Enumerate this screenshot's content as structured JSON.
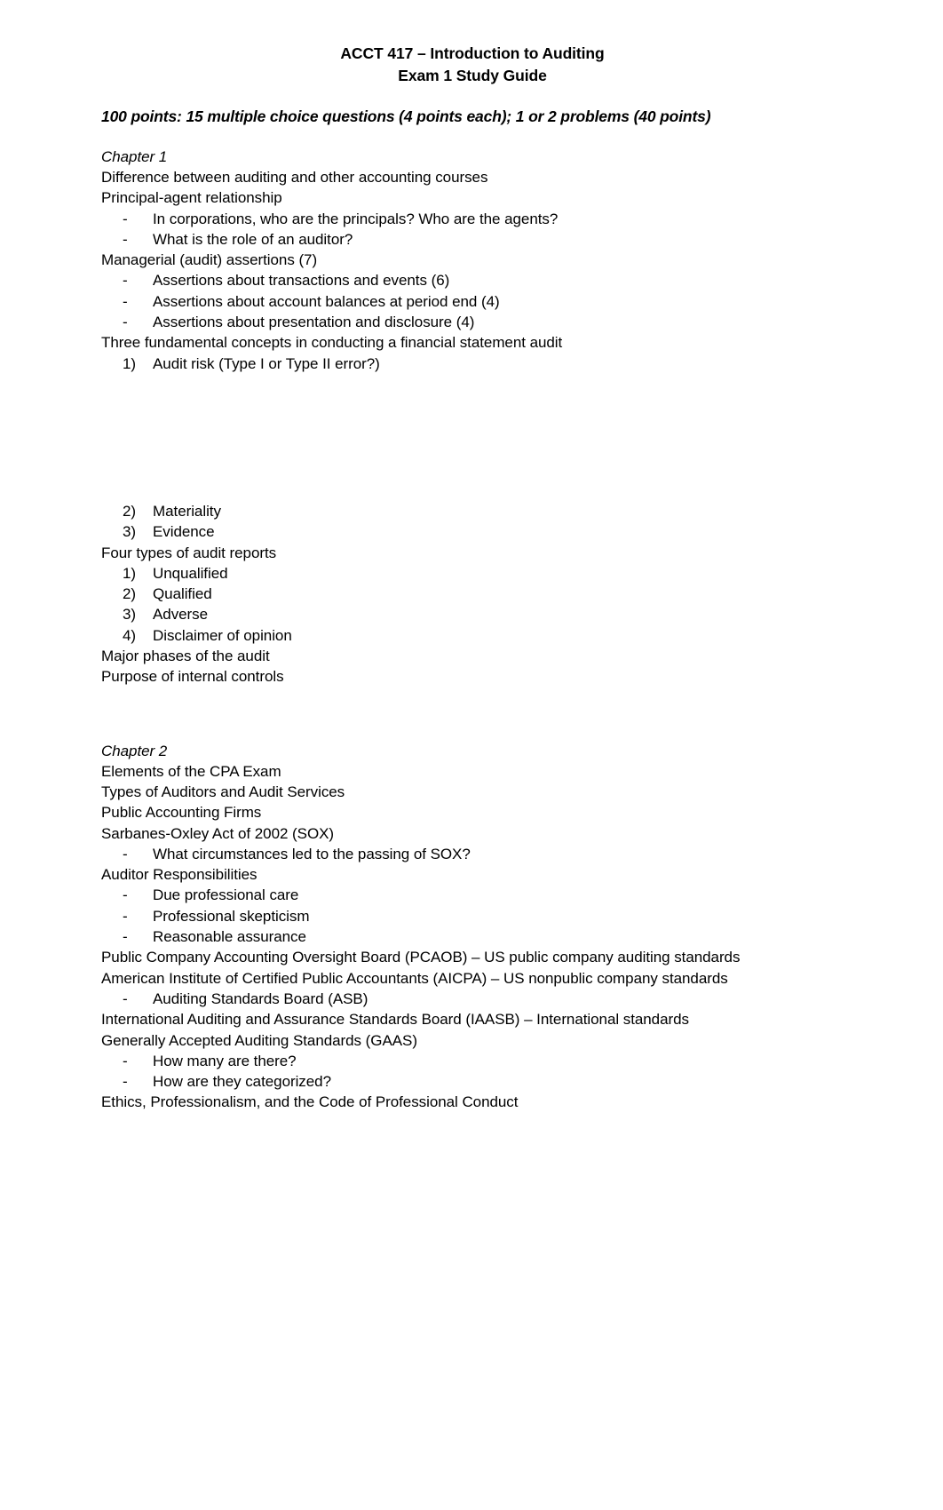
{
  "header": {
    "title": "ACCT 417 – Introduction to Auditing",
    "subtitle": "Exam 1 Study Guide",
    "exam_format": "100 points: 15 multiple choice questions (4 points each); 1 or 2 problems (40 points)"
  },
  "chapter1": {
    "heading": "Chapter 1",
    "line1": "Difference between auditing and other accounting courses",
    "line2": "Principal-agent relationship",
    "sub1": {
      "mark": "-",
      "text": "In corporations, who are the principals? Who are the agents?"
    },
    "sub2": {
      "mark": "-",
      "text": "What is the role of an auditor?"
    },
    "line3": "Managerial (audit) assertions (7)",
    "sub3": {
      "mark": "-",
      "text": "Assertions about transactions and events (6)"
    },
    "sub4": {
      "mark": "-",
      "text": "Assertions about account balances at period end (4)"
    },
    "sub5": {
      "mark": "-",
      "text": "Assertions about presentation and disclosure (4)"
    },
    "line4": "Three fundamental concepts in conducting a financial statement audit",
    "num1": {
      "mark": "1)",
      "text": "Audit risk (Type I or Type II error?)"
    },
    "num2": {
      "mark": "2)",
      "text": "Materiality"
    },
    "num3": {
      "mark": "3)",
      "text": "Evidence"
    },
    "line5": "Four types of audit reports",
    "rep1": {
      "mark": "1)",
      "text": "Unqualified"
    },
    "rep2": {
      "mark": "2)",
      "text": "Qualified"
    },
    "rep3": {
      "mark": "3)",
      "text": "Adverse"
    },
    "rep4": {
      "mark": "4)",
      "text": "Disclaimer of opinion"
    },
    "line6": "Major phases of the audit",
    "line7": "Purpose of internal controls"
  },
  "chapter2": {
    "heading": "Chapter 2",
    "line1": "Elements of the CPA Exam",
    "line2": "Types of Auditors and Audit Services",
    "line3": "Public Accounting Firms",
    "line4": "Sarbanes-Oxley Act of 2002 (SOX)",
    "sub1": {
      "mark": "-",
      "text": "What circumstances led to the passing of SOX?"
    },
    "line5": "Auditor Responsibilities",
    "sub2": {
      "mark": "-",
      "text": "Due professional care"
    },
    "sub3": {
      "mark": "-",
      "text": "Professional skepticism"
    },
    "sub4": {
      "mark": "-",
      "text": "Reasonable assurance"
    },
    "line6": "Public Company Accounting Oversight Board (PCAOB) – US public company auditing standards",
    "line7": "American Institute of Certified Public Accountants (AICPA) – US nonpublic company standards",
    "sub5": {
      "mark": "-",
      "text": "Auditing Standards Board (ASB)"
    },
    "line8": "International Auditing and Assurance Standards Board (IAASB) – International standards",
    "line9": "Generally Accepted Auditing Standards (GAAS)",
    "sub6": {
      "mark": "-",
      "text": "How many are there?"
    },
    "sub7": {
      "mark": "-",
      "text": "How are they categorized?"
    },
    "line10": "Ethics, Professionalism, and the Code of Professional Conduct"
  }
}
